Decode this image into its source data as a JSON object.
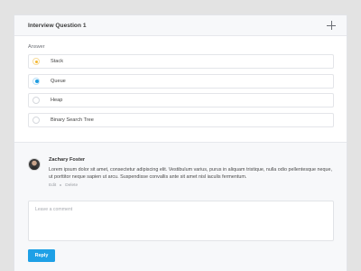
{
  "card": {
    "title": "Interview Question 1"
  },
  "answers": {
    "label": "Answer",
    "options": [
      {
        "text": "Stack",
        "state": "hover"
      },
      {
        "text": "Queue",
        "state": "checked"
      },
      {
        "text": "Heap",
        "state": "unchecked"
      },
      {
        "text": "Binary Search Tree",
        "state": "unchecked"
      }
    ]
  },
  "comment": {
    "author": "Zachary Foster",
    "text": "Lorem ipsum dolor sit amet, consectetur adipiscing elit. Vestibulum varius, purus in aliquam tristique, nulla odio pellentesque neque, ut porttitor neque sapien ut arcu. Suspendisse convallis ante sit amet nisl iaculis fermentum.",
    "edit_label": "Edit",
    "delete_label": "Delete"
  },
  "reply": {
    "placeholder": "Leave a comment",
    "button_label": "Reply"
  },
  "colors": {
    "accent": "#1ea0e6",
    "hover_dot": "#f5b731",
    "background": "#e3e3e3"
  },
  "icons": {
    "add": "plus-icon"
  }
}
